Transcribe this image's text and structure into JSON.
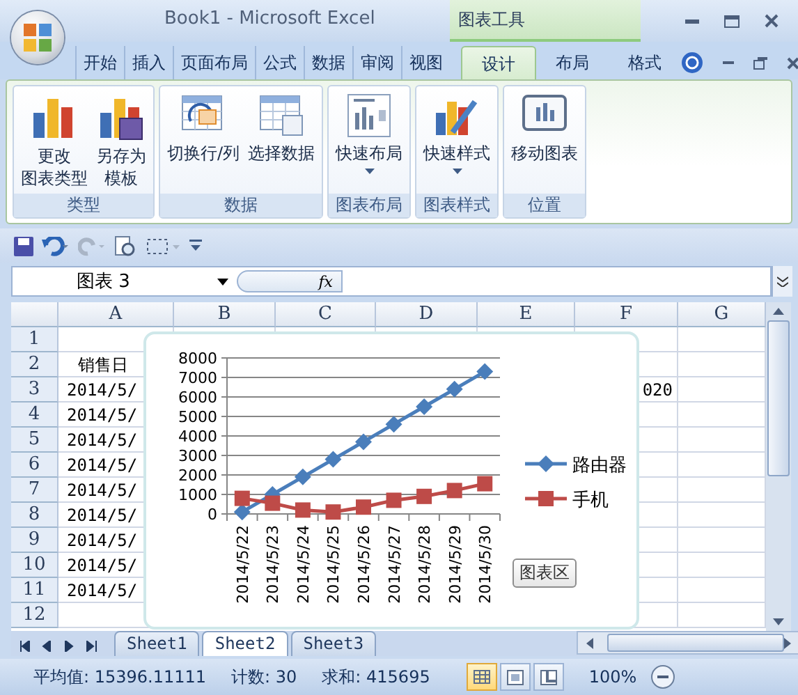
{
  "window": {
    "title": "Book1 - Microsoft Excel",
    "context_group": "图表工具"
  },
  "ribbon_tabs": [
    {
      "label": "开始",
      "selected": false,
      "context": false
    },
    {
      "label": "插入",
      "selected": false,
      "context": false
    },
    {
      "label": "页面布局",
      "selected": false,
      "context": false
    },
    {
      "label": "公式",
      "selected": false,
      "context": false
    },
    {
      "label": "数据",
      "selected": false,
      "context": false
    },
    {
      "label": "审阅",
      "selected": false,
      "context": false
    },
    {
      "label": "视图",
      "selected": false,
      "context": false
    },
    {
      "label": "设计",
      "selected": true,
      "context": true
    },
    {
      "label": "布局",
      "selected": false,
      "context": true
    },
    {
      "label": "格式",
      "selected": false,
      "context": true
    }
  ],
  "ribbon_groups": [
    {
      "label": "类型",
      "buttons": [
        {
          "kind": "change-type",
          "lines": [
            "更改",
            "图表类型"
          ],
          "dropdown": false
        },
        {
          "kind": "save-template",
          "lines": [
            "另存为",
            "模板"
          ],
          "dropdown": false
        }
      ]
    },
    {
      "label": "数据",
      "buttons": [
        {
          "kind": "switch",
          "lines": [
            "切换行/列"
          ],
          "dropdown": false
        },
        {
          "kind": "select-data",
          "lines": [
            "选择数据"
          ],
          "dropdown": false
        }
      ]
    },
    {
      "label": "图表布局",
      "buttons": [
        {
          "kind": "layout",
          "lines": [
            "快速布局"
          ],
          "dropdown": true
        }
      ]
    },
    {
      "label": "图表样式",
      "buttons": [
        {
          "kind": "style",
          "lines": [
            "快速样式"
          ],
          "dropdown": true
        }
      ]
    },
    {
      "label": "位置",
      "buttons": [
        {
          "kind": "move",
          "lines": [
            "移动图表"
          ],
          "dropdown": false
        }
      ]
    }
  ],
  "name_box": "图表 3",
  "function_label": "fx",
  "columns": [
    "A",
    "B",
    "C",
    "D",
    "E",
    "F",
    "G"
  ],
  "rows": [
    {
      "number": "1",
      "cells": {}
    },
    {
      "number": "2",
      "cells": {
        "A": "销售日"
      }
    },
    {
      "number": "3",
      "cells": {
        "A": "2014/5/",
        "F": "020"
      }
    },
    {
      "number": "4",
      "cells": {
        "A": "2014/5/"
      }
    },
    {
      "number": "5",
      "cells": {
        "A": "2014/5/"
      }
    },
    {
      "number": "6",
      "cells": {
        "A": "2014/5/"
      }
    },
    {
      "number": "7",
      "cells": {
        "A": "2014/5/"
      }
    },
    {
      "number": "8",
      "cells": {
        "A": "2014/5/"
      }
    },
    {
      "number": "9",
      "cells": {
        "A": "2014/5/"
      }
    },
    {
      "number": "10",
      "cells": {
        "A": "2014/5/"
      }
    },
    {
      "number": "11",
      "cells": {
        "A": "2014/5/"
      }
    },
    {
      "number": "12",
      "cells": {}
    }
  ],
  "chart": {
    "tooltip": "图表区",
    "chart_data": {
      "type": "line",
      "categories": [
        "2014/5/22",
        "2014/5/23",
        "2014/5/24",
        "2014/5/25",
        "2014/5/26",
        "2014/5/27",
        "2014/5/28",
        "2014/5/29",
        "2014/5/30"
      ],
      "series": [
        {
          "name": "路由器",
          "color": "#4a7ebb",
          "marker": "diamond",
          "values": [
            100,
            1000,
            1900,
            2800,
            3700,
            4600,
            5500,
            6400,
            7300
          ]
        },
        {
          "name": "手机",
          "color": "#be4b48",
          "marker": "square",
          "values": [
            800,
            550,
            200,
            100,
            350,
            700,
            900,
            1200,
            1550
          ]
        }
      ],
      "grid": true,
      "legend": true,
      "ylim": [
        0,
        8000
      ],
      "yticks": [
        0,
        1000,
        2000,
        3000,
        4000,
        5000,
        6000,
        7000,
        8000
      ]
    }
  },
  "sheet_tabs": [
    {
      "label": "Sheet1",
      "selected": false
    },
    {
      "label": "Sheet2",
      "selected": true
    },
    {
      "label": "Sheet3",
      "selected": false
    }
  ],
  "status_bar": {
    "average": "平均值: 15396.11111",
    "count": "计数: 30",
    "sum": "求和: 415695",
    "zoom": "100%"
  },
  "view_buttons": [
    {
      "kind": "normal",
      "selected": true
    },
    {
      "kind": "page-layout",
      "selected": false
    },
    {
      "kind": "page-break",
      "selected": false
    }
  ]
}
